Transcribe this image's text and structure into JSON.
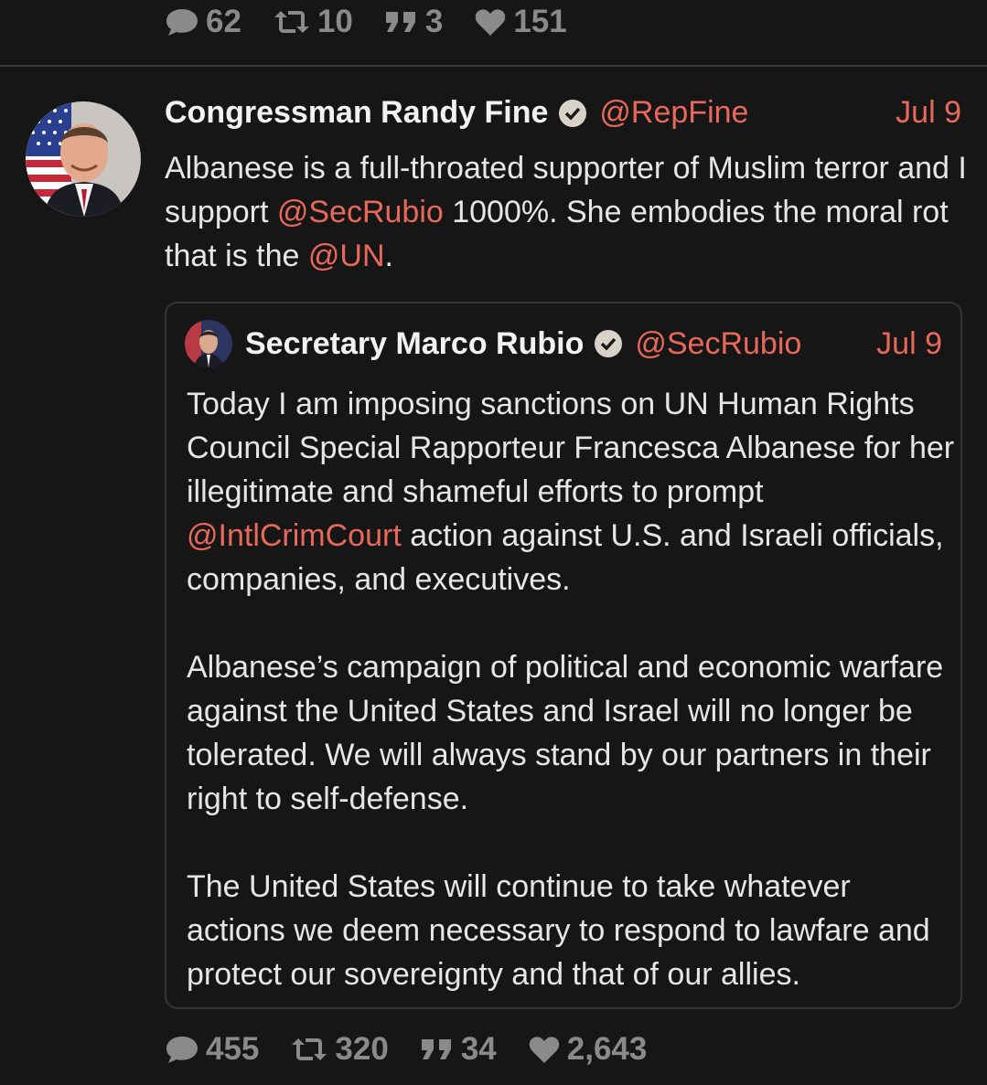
{
  "top_stats": {
    "replies": "62",
    "retweets": "10",
    "quotes": "3",
    "likes": "151"
  },
  "post": {
    "author_name": "Congressman Randy Fine",
    "handle": "@RepFine",
    "date": "Jul 9",
    "text": {
      "t1": "Albanese is a full-throated supporter of Muslim terror and I support ",
      "m1": "@SecRubio",
      "t2": " 1000%.   She embodies the moral rot that is the ",
      "m2": "@UN",
      "t3": "."
    },
    "stats": {
      "replies": "455",
      "retweets": "320",
      "quotes": "34",
      "likes": "2,643"
    }
  },
  "quoted_post": {
    "author_name": "Secretary Marco Rubio",
    "handle": "@SecRubio",
    "date": "Jul 9",
    "p1_a": "Today I am imposing sanctions on UN Human Rights Council Special Rapporteur Francesca Albanese for her illegitimate and shameful efforts to prompt ",
    "p1_mention": "@IntlCrimCourt",
    "p1_b": " action against U.S. and Israeli officials, companies, and executives.",
    "p2": "Albanese’s campaign of political and economic warfare against the United States and Israel will no longer be tolerated. We will always stand by our partners in their right to self-defense.",
    "p3": "The United States will continue to take whatever actions we deem necessary to respond to lawfare and protect our sovereignty and that of our allies."
  },
  "colors": {
    "background": "#161616",
    "accent": "#e8685a",
    "muted": "#8a8a8a",
    "text": "#e6e6e6"
  },
  "icons": [
    "reply-icon",
    "retweet-icon",
    "quote-icon",
    "like-icon",
    "verified-icon"
  ]
}
